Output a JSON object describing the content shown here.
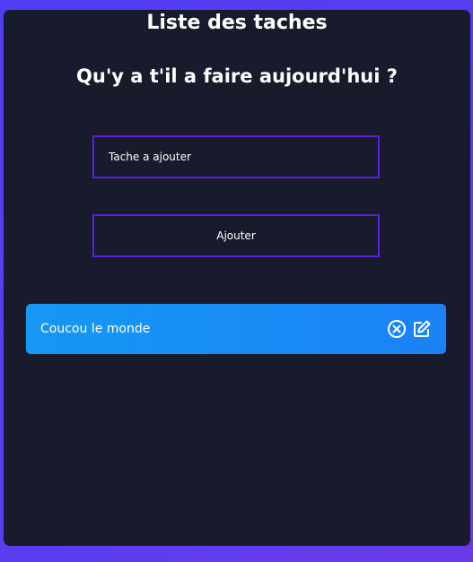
{
  "header": {
    "title": "Liste des taches",
    "subtitle": "Qu'y a t'il a faire aujourd'hui ?"
  },
  "form": {
    "input_placeholder": "Tache a ajouter",
    "input_value": "",
    "add_button_label": "Ajouter"
  },
  "tasks": [
    {
      "text": "Coucou le monde",
      "delete_icon": "circle-x-icon",
      "edit_icon": "edit-pencil-icon"
    }
  ],
  "colors": {
    "background": "#4f3df5",
    "panel": "#181b2c",
    "field_border": "#5a1fe0",
    "task_background": "#1698f4",
    "text": "#ffffff"
  }
}
